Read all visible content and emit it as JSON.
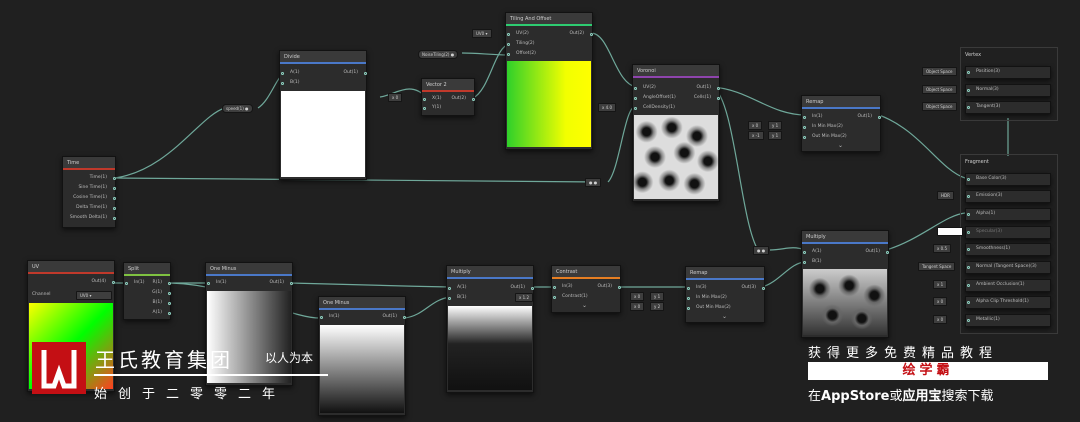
{
  "nodes": {
    "time": {
      "title": "Time",
      "outputs": [
        "Time(1)",
        "Sine Time(1)",
        "Cosine Time(1)",
        "Delta Time(1)",
        "Smooth Delta(1)"
      ],
      "color": "#c0392b"
    },
    "divide": {
      "title": "Divide",
      "inputs": [
        "A(1)",
        "B(1)"
      ],
      "output": "Out(1)",
      "color": "#4a78c8"
    },
    "speed": {
      "label": "speed(1)"
    },
    "vector2": {
      "title": "Vector 2",
      "inputs": [
        "X(1)",
        "Y(1)"
      ],
      "output": "Out(2)",
      "color": "#c0392b",
      "x_val": "0"
    },
    "noise_tiling": {
      "label": "NoiseTiling(2)"
    },
    "tiling_offset": {
      "title": "Tiling And Offset",
      "inputs": [
        "UV(2)",
        "Tiling(2)",
        "Offset(2)"
      ],
      "output": "Out(2)",
      "uv_select": "UV0",
      "color": "#2ecc71"
    },
    "voronoi": {
      "title": "Voronoi",
      "inputs": [
        "UV(2)",
        "AngleOffset(1)",
        "CellDensity(1)"
      ],
      "outputs": [
        "Out(1)",
        "Cells(1)"
      ],
      "angle_val": "4.0",
      "color": "#8e44ad"
    },
    "remap_top": {
      "title": "Remap",
      "inputs": [
        "In(1)",
        "In Min Max(2)",
        "Out Min Max(2)"
      ],
      "output": "Out(1)",
      "vals": [
        "0",
        "1",
        "-1",
        "1"
      ],
      "color": "#4a78c8"
    },
    "uv": {
      "title": "UV",
      "output": "Out(4)",
      "channel_label": "Channel",
      "channel_value": "UV0",
      "color": "#c0392b"
    },
    "split": {
      "title": "Split",
      "input": "In(1)",
      "outputs": [
        "R(1)",
        "G(1)",
        "B(1)",
        "A(1)"
      ],
      "color": "#7fc241"
    },
    "one_minus_1": {
      "title": "One Minus",
      "input": "In(1)",
      "output": "Out(1)",
      "color": "#4a78c8"
    },
    "one_minus_2": {
      "title": "One Minus",
      "input": "In(1)",
      "output": "Out(1)",
      "color": "#4a78c8"
    },
    "multiply_1": {
      "title": "Multiply",
      "inputs": [
        "A(1)",
        "B(1)"
      ],
      "output": "Out(1)",
      "b_val": "1.2",
      "color": "#4a78c8"
    },
    "contrast": {
      "title": "Contrast",
      "inputs": [
        "In(3)",
        "Contrast(1)"
      ],
      "output": "Out(3)",
      "color": "#e67e22"
    },
    "remap_bottom": {
      "title": "Remap",
      "inputs": [
        "In(3)",
        "In Min Max(2)",
        "Out Min Max(2)"
      ],
      "output": "Out(3)",
      "vals": [
        "0",
        "1",
        "0",
        "2"
      ],
      "color": "#4a78c8"
    },
    "multiply_2": {
      "title": "Multiply",
      "inputs": [
        "A(1)",
        "B(1)"
      ],
      "output": "Out(1)",
      "color": "#4a78c8"
    }
  },
  "vertex": {
    "title": "Vertex",
    "ports": [
      {
        "space": "Object Space",
        "label": "Position(3)"
      },
      {
        "space": "Object Space",
        "label": "Normal(3)"
      },
      {
        "space": "Object Space",
        "label": "Tangent(3)"
      }
    ]
  },
  "fragment": {
    "title": "Fragment",
    "ports": [
      {
        "value": "",
        "label": "Base Color(3)"
      },
      {
        "value": "HDR",
        "label": "Emission(3)"
      },
      {
        "value": "",
        "label": "Alpha(1)"
      },
      {
        "value": "",
        "label": "Specular(3)"
      },
      {
        "value": "0.5",
        "label": "Smoothness(1)"
      },
      {
        "value": "Tangent Space",
        "label": "Normal (Tangent Space)(3)"
      },
      {
        "value": "1",
        "label": "Ambient Occlusion(1)"
      },
      {
        "value": "0",
        "label": "Alpha Clip Threshold(1)"
      },
      {
        "value": "0",
        "label": "Metallic(1)"
      }
    ]
  },
  "watermark": {
    "brand_title": "王氏教育集团",
    "slogan": "以人为本",
    "founded": "始创于二零零二年"
  },
  "ad": {
    "line1": "获得更多免费精品教程",
    "app_name": "绘学霸",
    "line3_pre": "在",
    "line3_store": "AppStore",
    "line3_or": "或",
    "line3_yyb": "应用宝",
    "line3_post": "搜索下载"
  },
  "colors": {
    "wire": "#6fa89a",
    "port": "#8fd3c3",
    "bg": "#202020",
    "brand_red": "#c40f14"
  }
}
